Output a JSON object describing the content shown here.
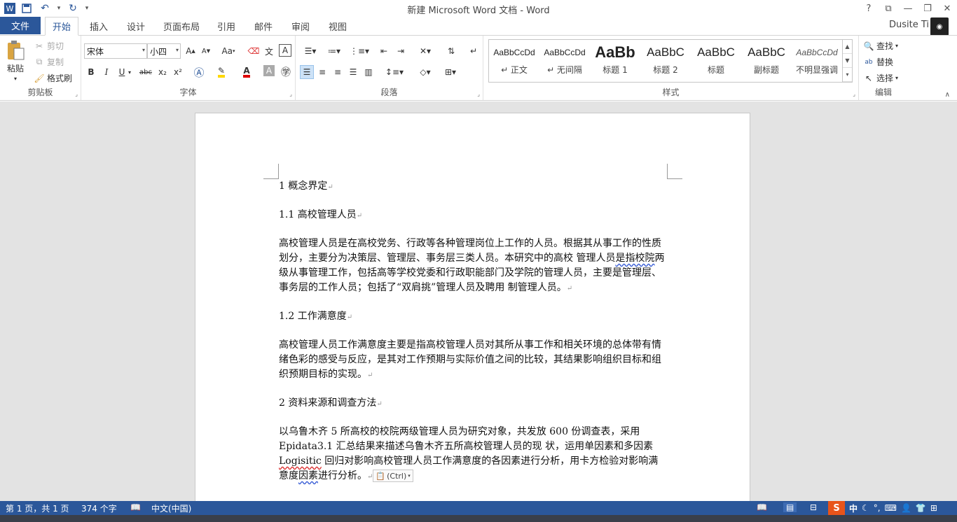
{
  "window": {
    "title": "新建 Microsoft Word 文档 - Word",
    "help": "?",
    "user_name": "Dusite Ti"
  },
  "tabs": {
    "file": "文件",
    "items": [
      "开始",
      "插入",
      "设计",
      "页面布局",
      "引用",
      "邮件",
      "审阅",
      "视图"
    ],
    "active": "开始"
  },
  "ribbon": {
    "clipboard": {
      "label": "剪贴板",
      "paste": "粘贴",
      "cut": "剪切",
      "copy": "复制",
      "format_painter": "格式刷"
    },
    "font": {
      "label": "字体",
      "font_name": "宋体",
      "font_size": "小四",
      "bold": "B",
      "italic": "I",
      "underline": "U",
      "strike": "abc",
      "subscript": "x₂",
      "superscript": "x²",
      "change_case": "Aa",
      "grow": "A",
      "shrink": "A",
      "pinyin": "文",
      "border_char": "A"
    },
    "paragraph": {
      "label": "段落"
    },
    "styles": {
      "label": "样式",
      "items": [
        {
          "sample": "AaBbCcDd",
          "name": "↵ 正文"
        },
        {
          "sample": "AaBbCcDd",
          "name": "↵ 无间隔"
        },
        {
          "sample": "AaBb",
          "name": "标题 1"
        },
        {
          "sample": "AaBbC",
          "name": "标题 2"
        },
        {
          "sample": "AaBbC",
          "name": "标题"
        },
        {
          "sample": "AaBbC",
          "name": "副标题"
        },
        {
          "sample": "AaBbCcDd",
          "name": "不明显强调"
        }
      ]
    },
    "editing": {
      "label": "编辑",
      "find": "查找",
      "replace": "替换",
      "select": "选择"
    }
  },
  "document": {
    "heading1": "1 概念界定",
    "heading1_1": "1.1 高校管理人员",
    "para1_a": "高校管理人员是在高校党务、行政等各种管理岗位上工作的人员。根据其从事工作的性质划分，主要分为决策层、管理层、事务层三类人员。本研究中的高校 管理人员",
    "para1_wavy": "是指校院",
    "para1_b": "两级从事管理工作，包括高等学校党委和行政职能部门及学院的管理人员，主要是管理层、事务层的工作人员；包括了“双肩挑”管理人员及聘用 制管理人员。",
    "heading1_2": "1.2 工作满意度",
    "para2": "高校管理人员工作满意度主要是指高校管理人员对其所从事工作和相关环境的总体带有情绪色彩的感受与反应，是其对工作预期与实际价值之间的比较，其结果影响组织目标和组织预期目标的实现。",
    "heading2": "2 资料来源和调查方法",
    "para3_a": "以乌鲁木齐 5 所高校的校院两级管理人员为研究对象，共发放 600 份调查表，采用 Epidata3.1 汇总结果来描述乌鲁木齐五所高校管理人员的现 状，运用单因素和多因素 ",
    "para3_red": "Logisitic",
    "para3_b": " 回归对影响高校管理人员工作满意度的各因素进行分析，用卡方检验对影响满意度",
    "para3_wavy": "因素",
    "para3_c": "进行分析。",
    "paste_tag": "(Ctrl)"
  },
  "statusbar": {
    "page": "第 1 页，共 1 页",
    "words": "374 个字",
    "language": "中文(中国)",
    "ime_logo": "S",
    "ime_mode": "中"
  },
  "colors": {
    "accent": "#2b579a"
  }
}
